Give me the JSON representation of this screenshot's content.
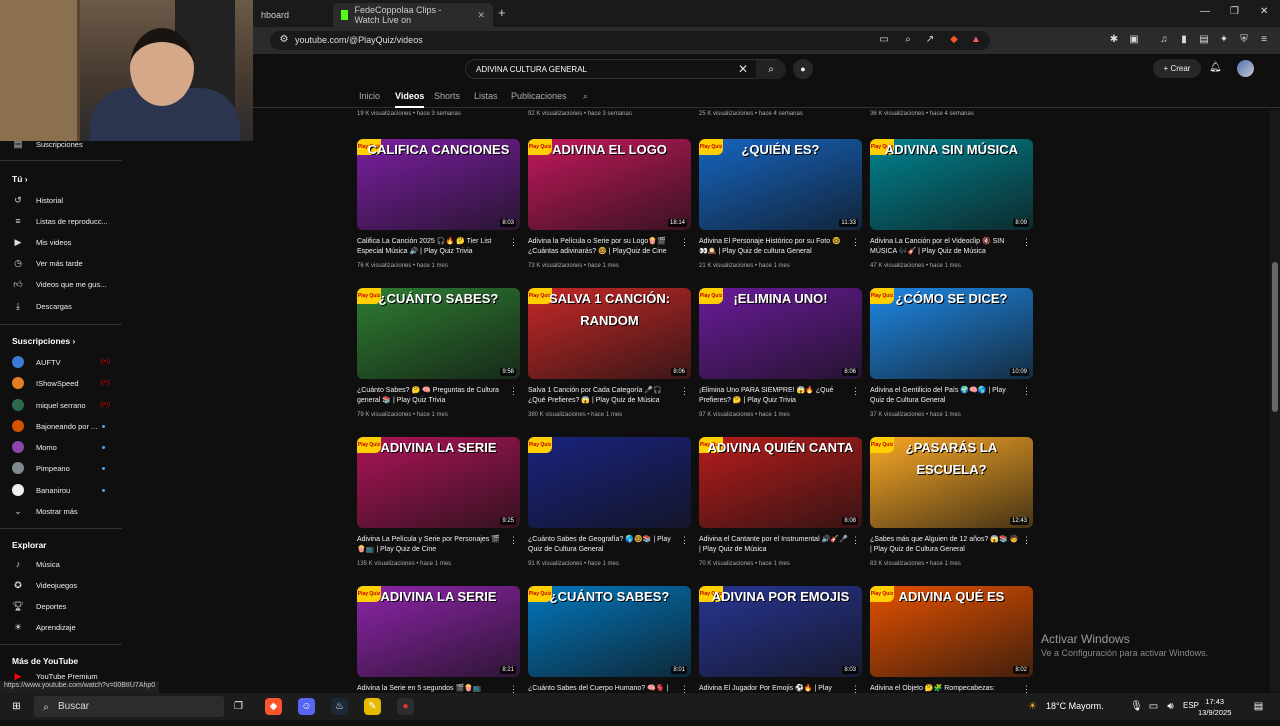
{
  "browser": {
    "tabs": [
      {
        "label": "hboard"
      },
      {
        "label": "FedeCoppolaa Clips - Watch Live on"
      }
    ],
    "url": "youtube.com/@PlayQuiz/videos",
    "status_url": "https://www.youtube.com/watch?v=00BtIU7Ahp0"
  },
  "header": {
    "search_value": "ADIVINA CULTURA GENERAL",
    "create_label": "Crear"
  },
  "channel_tabs": [
    "Inicio",
    "Videos",
    "Shorts",
    "Listas",
    "Publicaciones"
  ],
  "sidebar": {
    "top_item": "Suscripciones",
    "you_heading": "Tú",
    "you_items": [
      "Historial",
      "Listas de reproducc...",
      "Mis videos",
      "Ver más tarde",
      "Videos que me gus...",
      "Descargas"
    ],
    "subs_heading": "Suscripciones",
    "subs": [
      {
        "name": "AUFTV",
        "state": "live"
      },
      {
        "name": "IShowSpeed",
        "state": "live"
      },
      {
        "name": "miquel serrano",
        "state": "live"
      },
      {
        "name": "Bajoneando por ...",
        "state": "dot"
      },
      {
        "name": "Momo",
        "state": "dot"
      },
      {
        "name": "Pimpeano",
        "state": "dot"
      },
      {
        "name": "Bananirou",
        "state": "dot"
      }
    ],
    "show_more": "Mostrar más",
    "explore_heading": "Explorar",
    "explore_items": [
      "Música",
      "Videojuegos",
      "Deportes",
      "Aprendizaje"
    ],
    "more_heading": "Más de YouTube",
    "more_items": [
      "YouTube Premium"
    ]
  },
  "top_meta": [
    "19 K visualizaciones • hace 3 semanas",
    "92 K visualizaciones • hace 3 semanas",
    "25 K visualizaciones • hace 4 semanas",
    "36 K visualizaciones • hace 4 semanas"
  ],
  "videos": [
    {
      "thumb": "CALIFICA CANCIONES",
      "color": "#7b1fa2",
      "dur": "8:03",
      "title": "Califica La Canción 2025 🎧🔥 🤔 Tier List Especial Música 🔊 | Play Quiz Trivia",
      "meta": "76 K visualizaciones • hace 1 mes"
    },
    {
      "thumb": "ADIVINA EL LOGO",
      "color": "#c2185b",
      "dur": "18:14",
      "title": "Adivina la Película o Serie por su Logo🍿🎬 ¿Cuántas adivinarás? 🤓 | PlayQuiz de Cine",
      "meta": "73 K visualizaciones • hace 1 mes"
    },
    {
      "thumb": "¿QUIÉN ES?",
      "color": "#1565c0",
      "dur": "11:33",
      "title": "Adivina El Personaje Histórico por su Foto 🤓👀🕰️ | Play Quiz de cultura General",
      "meta": "21 K visualizaciones • hace 1 mes"
    },
    {
      "thumb": "ADIVINA SIN MÚSICA",
      "color": "#00838f",
      "dur": "8:09",
      "title": "Adivina La Canción por el Videoclip 🔇 SIN MÚSICA 🎶🎸 | Play Quiz de Música",
      "meta": "47 K visualizaciones • hace 1 mes"
    },
    {
      "thumb": "¿CUÁNTO SABES?",
      "color": "#2e7d32",
      "dur": "9:58",
      "title": "¿Cuánto Sabes? 🤔 🧠 Preguntas de Cultura general 📚 | Play Quiz Trivia",
      "meta": "79 K visualizaciones • hace 1 mes"
    },
    {
      "thumb": "SALVA 1 CANCIÓN: RANDOM",
      "color": "#c62828",
      "dur": "8:06",
      "title": "Salva 1 Canción por Cada Categoría 🎤🎧 ¿Qué Prefieres? 😱 | Play Quiz de Música",
      "meta": "380 K visualizaciones • hace 1 mes"
    },
    {
      "thumb": "¡ELIMINA UNO!",
      "color": "#6a1b9a",
      "dur": "8:06",
      "title": "¡Elimina Uno PARA SIEMPRE! 😱🔥 ¿Qué Prefieres? 🤔 | Play Quiz Trivia",
      "meta": "97 K visualizaciones • hace 1 mes"
    },
    {
      "thumb": "¿CÓMO SE DICE?",
      "color": "#1e88e5",
      "dur": "10:09",
      "title": "Adivina el Gentilicio del País 🌍🧠🌎 | Play Quiz de Cultura General",
      "meta": "37 K visualizaciones • hace 1 mes"
    },
    {
      "thumb": "ADIVINA LA SERIE",
      "color": "#ad1457",
      "dur": "9:25",
      "title": "Adivina La Película y Serie por Personajes 🎬🍿📺 | Play Quiz de Cine",
      "meta": "135 K visualizaciones • hace 1 mes"
    },
    {
      "thumb": "",
      "color": "#1a237e",
      "dur": "",
      "title": "¿Cuánto Sabes de Geografía? 🌎🤓📚 | Play Quiz de Cultura General",
      "meta": "91 K visualizaciones • hace 1 mes"
    },
    {
      "thumb": "ADIVINA QUIÉN CANTA",
      "color": "#b71c1c",
      "dur": "8:08",
      "title": "Adivina el Cantante por el Instrumental 🔊🎸🎤 | Play Quiz de Música",
      "meta": "70 K visualizaciones • hace 1 mes"
    },
    {
      "thumb": "¿PASARÁS LA ESCUELA?",
      "color": "#f9a825",
      "dur": "12:43",
      "title": "¿Sabes más que Alguien de 12 años? 😱📚 🧒 | Play Quiz de Cultura General",
      "meta": "83 K visualizaciones • hace 1 mes"
    },
    {
      "thumb": "ADIVINA LA SERIE",
      "color": "#8e24aa",
      "dur": "8:21",
      "title": "Adivina la Serie en 5 segundos 🎬🍿📺",
      "meta": ""
    },
    {
      "thumb": "¿CUÁNTO SABES?",
      "color": "#0277bd",
      "dur": "8:01",
      "title": "¿Cuánto Sabes del Cuerpo Humano? 🧠🫀 |",
      "meta": ""
    },
    {
      "thumb": "ADIVINA POR EMOJIS",
      "color": "#283593",
      "dur": "8:03",
      "title": "Adivina El Jugador Por Emojis ⚽🔥 | Play",
      "meta": ""
    },
    {
      "thumb": "ADIVINA QUÉ ES",
      "color": "#e65100",
      "dur": "8:02",
      "title": "Adivina el Objeto 🤔🧩 Rompecabezas:",
      "meta": ""
    }
  ],
  "watermark": {
    "line1": "Activar Windows",
    "line2": "Ve a Configuración para activar Windows."
  },
  "taskbar": {
    "search": "Buscar",
    "weather": "18°C  Mayorm.",
    "lang": "ESP",
    "time": "17:43",
    "date": "13/9/2025"
  }
}
